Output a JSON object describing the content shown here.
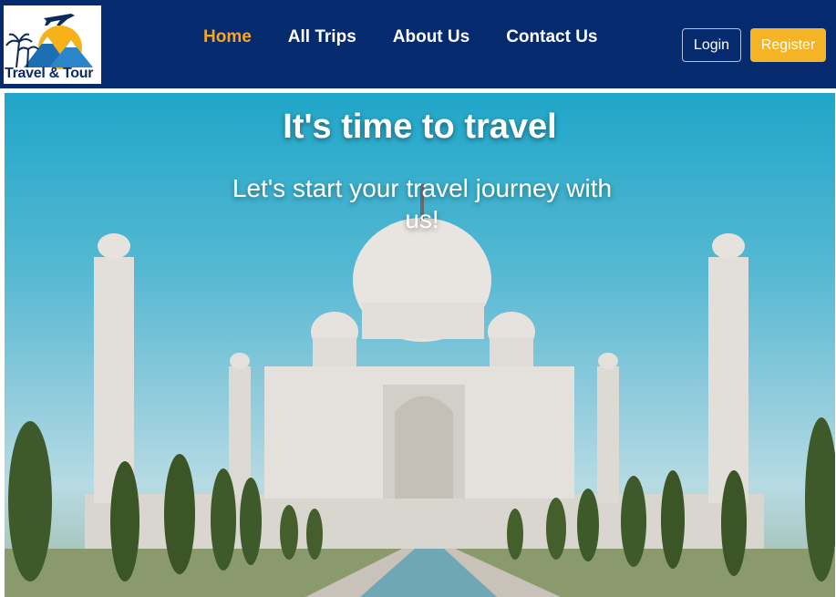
{
  "brand": {
    "logo_text": "Travel & Tour"
  },
  "nav": {
    "items": [
      {
        "label": "Home",
        "active": true
      },
      {
        "label": "All Trips",
        "active": false
      },
      {
        "label": "About Us",
        "active": false
      },
      {
        "label": "Contact Us",
        "active": false
      }
    ],
    "login_label": "Login",
    "register_label": "Register"
  },
  "hero": {
    "title": "It's time to travel",
    "subtitle": "Let's start your travel journey with us!",
    "image_icon": "taj-mahal-photo"
  },
  "colors": {
    "navbar_bg": "#062a6e",
    "accent": "#f4b425",
    "active_link": "#f5a623"
  }
}
